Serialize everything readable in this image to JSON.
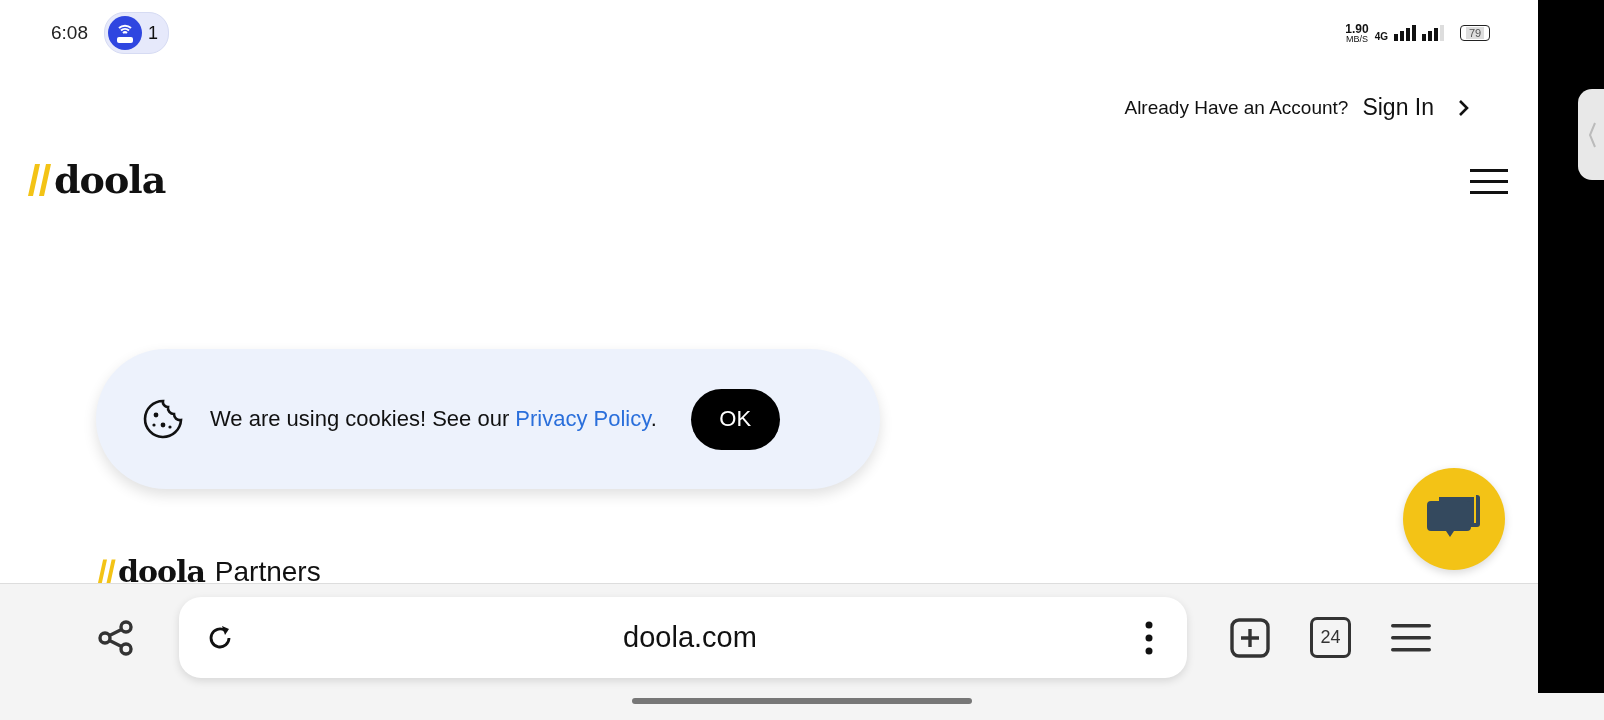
{
  "status_bar": {
    "time": "6:08",
    "notification_count": "1",
    "net_speed": "1.90",
    "net_speed_unit": "MB/S",
    "network": "4G",
    "battery": "79"
  },
  "header": {
    "account_prompt": "Already Have an Account?",
    "sign_in": "Sign In",
    "logo": "doola"
  },
  "partners_heading": {
    "logo": "doola",
    "title": "Partners"
  },
  "cookie_banner": {
    "text": "We are using cookies! See our ",
    "link": "Privacy Policy",
    "after": ".",
    "button": "OK"
  },
  "browser_toolbar": {
    "url": "doola.com",
    "tab_count": "24"
  }
}
